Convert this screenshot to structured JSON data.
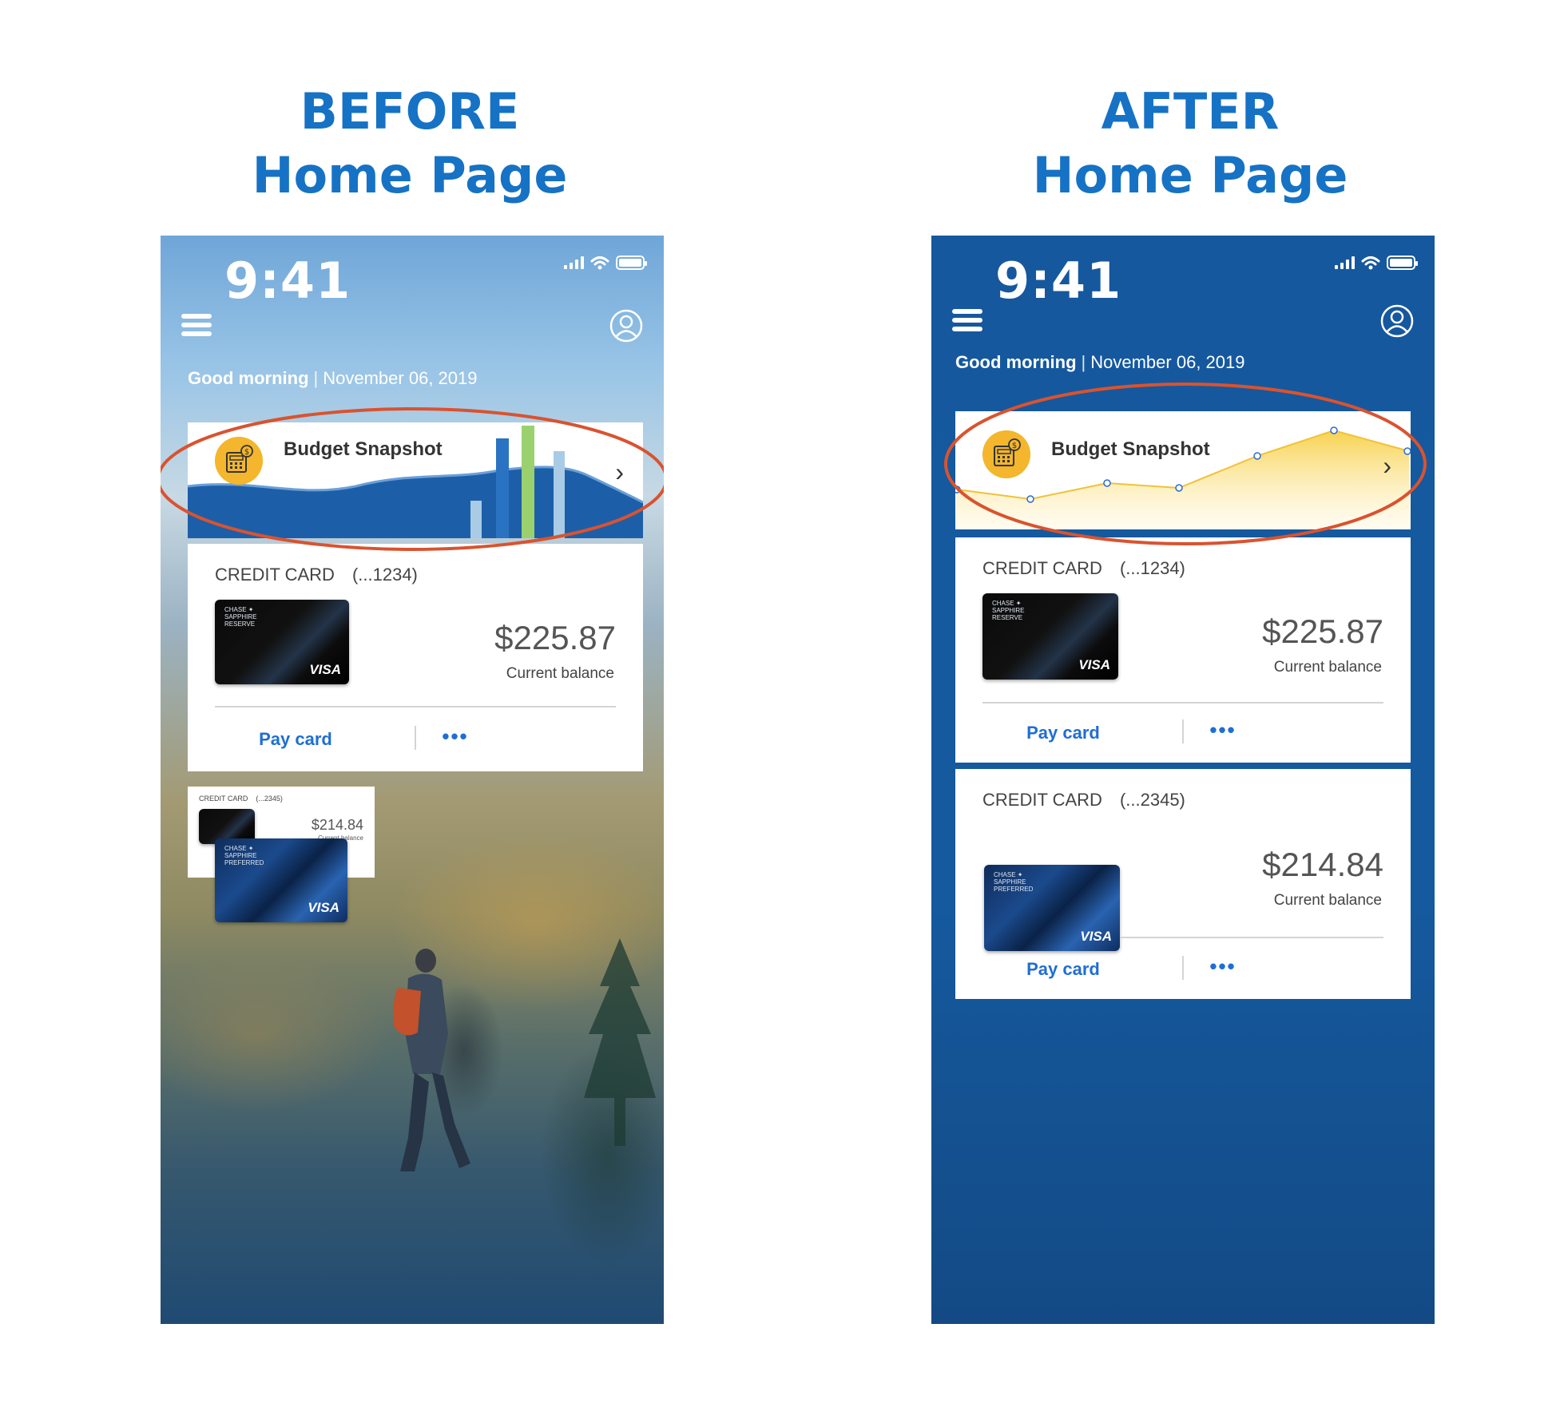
{
  "before": {
    "heading": {
      "line1": "BEFORE",
      "line2": "Home Page"
    },
    "status": {
      "time": "9:41"
    },
    "greeting": {
      "salutation": "Good morning",
      "separator": "|",
      "date": "November 06, 2019"
    },
    "snapshot": {
      "title": "Budget Snapshot",
      "chevron": "›"
    },
    "card1": {
      "label": "CREDIT CARD",
      "number": "(...1234)",
      "amount": "$225.87",
      "caption": "Current balance",
      "pay_label": "Pay card",
      "more_label": "•••",
      "card_brand": "CHASE ✦ SAPPHIRE RESERVE",
      "card_network": "VISA"
    },
    "card2": {
      "label": "CREDIT CARD",
      "number": "(...2345)",
      "amount": "$214.84",
      "caption": "Current balance",
      "card_brand": "CHASE ✦ SAPPHIRE PREFERRED",
      "card_network": "VISA"
    }
  },
  "after": {
    "heading": {
      "line1": "AFTER",
      "line2": "Home Page"
    },
    "status": {
      "time": "9:41"
    },
    "greeting": {
      "salutation": "Good morning",
      "separator": "|",
      "date": "November 06, 2019"
    },
    "snapshot": {
      "title": "Budget Snapshot",
      "chevron": "›"
    },
    "card1": {
      "label": "CREDIT CARD",
      "number": "(...1234)",
      "amount": "$225.87",
      "caption": "Current balance",
      "pay_label": "Pay card",
      "more_label": "•••",
      "card_brand": "CHASE ✦ SAPPHIRE RESERVE",
      "card_network": "VISA"
    },
    "card2": {
      "label": "CREDIT CARD",
      "number": "(...2345)",
      "amount": "$214.84",
      "caption": "Current balance",
      "pay_label": "Pay card",
      "more_label": "•••",
      "card_brand": "CHASE ✦ SAPPHIRE PREFERRED",
      "card_network": "VISA"
    }
  },
  "colors": {
    "heading": "#1672c4",
    "accent_blue": "#1f6ed4",
    "highlight_ellipse": "#d9532f",
    "coin": "#f3b62c",
    "after_bg": "#15589e"
  },
  "icons": [
    "menu-icon",
    "profile-icon",
    "signal-icon",
    "wifi-icon",
    "battery-icon",
    "calculator-coin-icon",
    "chevron-right-icon",
    "more-icon"
  ]
}
